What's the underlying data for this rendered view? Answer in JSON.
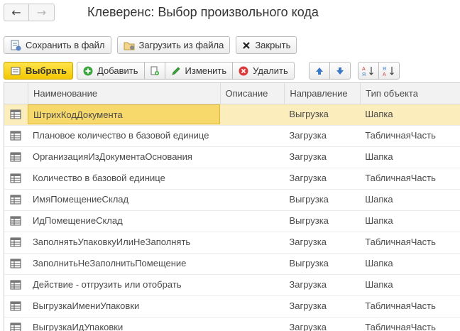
{
  "window": {
    "title": "Клеверенс: Выбор произвольного кода",
    "nav": {
      "back_icon": "arrow-left-icon",
      "forward_icon": "arrow-right-icon"
    }
  },
  "toolbar_top": {
    "save_label": "Сохранить в файл",
    "load_label": "Загрузить из файла",
    "close_label": "Закрыть"
  },
  "toolbar_main": {
    "select_label": "Выбрать",
    "add_label": "Добавить",
    "edit_label": "Изменить",
    "delete_label": "Удалить",
    "sort_asc_icon": "sort-asc-icon",
    "sort_desc_icon": "sort-desc-icon",
    "move_up_icon": "arrow-up-icon",
    "move_down_icon": "arrow-down-icon",
    "accent": "#f3c700"
  },
  "table": {
    "columns": [
      "Наименование",
      "Описание",
      "Направление",
      "Тип объекта"
    ],
    "rows": [
      {
        "name": "ШтрихКодДокумента",
        "description": "",
        "direction": "Выгрузка",
        "type": "Шапка"
      },
      {
        "name": "Плановое количество в базовой единице",
        "description": "",
        "direction": "Загрузка",
        "type": "ТабличнаяЧасть"
      },
      {
        "name": "ОрганизацияИзДокументаОснования",
        "description": "",
        "direction": "Загрузка",
        "type": "Шапка"
      },
      {
        "name": "Количество в базовой единице",
        "description": "",
        "direction": "Загрузка",
        "type": "ТабличнаяЧасть"
      },
      {
        "name": "ИмяПомещениеСклад",
        "description": "",
        "direction": "Выгрузка",
        "type": "Шапка"
      },
      {
        "name": "ИдПомещениеСклад",
        "description": "",
        "direction": "Выгрузка",
        "type": "Шапка"
      },
      {
        "name": "ЗаполнятьУпаковкуИлиНеЗаполнять",
        "description": "",
        "direction": "Загрузка",
        "type": "ТабличнаяЧасть"
      },
      {
        "name": "ЗаполнитьНеЗаполнитьПомещение",
        "description": "",
        "direction": "Выгрузка",
        "type": "Шапка"
      },
      {
        "name": "Действие - отгрузить или отобрать",
        "description": "",
        "direction": "Загрузка",
        "type": "Шапка"
      },
      {
        "name": "ВыгрузкаИмениУпаковки",
        "description": "",
        "direction": "Загрузка",
        "type": "ТабличнаяЧасть"
      },
      {
        "name": "ВыгрузкаИдУпаковки",
        "description": "",
        "direction": "Загрузка",
        "type": "ТабличнаяЧасть"
      }
    ]
  }
}
